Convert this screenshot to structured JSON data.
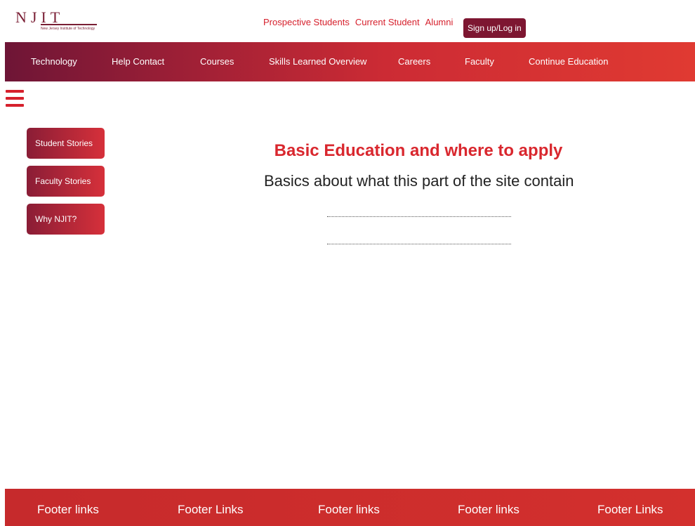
{
  "brand": {
    "logo_text": "NJIT",
    "logo_subtitle": "New Jersey Institute of Technology"
  },
  "top_links": [
    "Prospective Students",
    "Current Student",
    "Alumni"
  ],
  "signup_label": "Sign up/Log in",
  "nav": [
    "Technology",
    "Help Contact",
    "Courses",
    "Skills Learned Overview",
    "Careers",
    "Faculty",
    "Continue Education"
  ],
  "sidebar": [
    "Student Stories",
    "Faculty Stories",
    "Why NJIT?"
  ],
  "main": {
    "title": "Basic Education and where to apply",
    "subtitle": "Basics about what this part of the site contain"
  },
  "footer": [
    "Footer links",
    "Footer Links",
    "Footer links",
    "Footer links",
    "Footer Links"
  ],
  "colors": {
    "accent": "#d9272e",
    "brand_dark": "#7d1631"
  }
}
